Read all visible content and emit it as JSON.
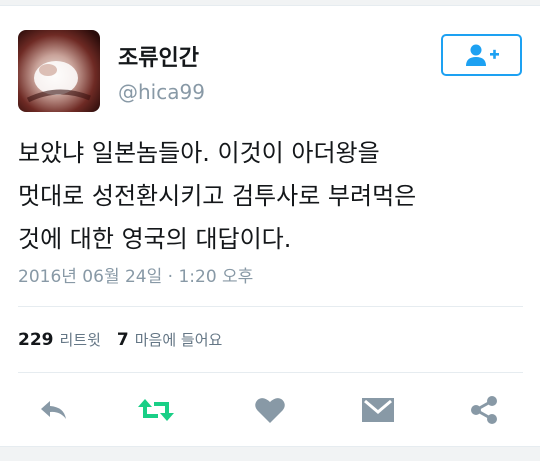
{
  "author": {
    "display_name": "조류인간",
    "handle": "@hica99"
  },
  "tweet": {
    "lines": [
      "보았냐 일본놈들아. 이것이 아더왕을",
      "멋대로 성전환시키고 검투사로 부려먹은",
      "것에 대한 영국의 대답이다."
    ],
    "timestamp": "2016년 06월 24일 · 1:20 오후"
  },
  "stats": {
    "retweets_count": "229",
    "retweets_label": "리트윗",
    "likes_count": "7",
    "likes_label": "마음에 들어요"
  },
  "actions": {
    "reply_icon": "reply-icon",
    "retweet_icon": "retweet-icon",
    "like_icon": "heart-icon",
    "dm_icon": "envelope-icon",
    "share_icon": "share-icon"
  },
  "colors": {
    "accent": "#1da1f2",
    "retweet_green": "#19cf86",
    "icon_gray": "#8899a6",
    "text": "#14171a"
  }
}
